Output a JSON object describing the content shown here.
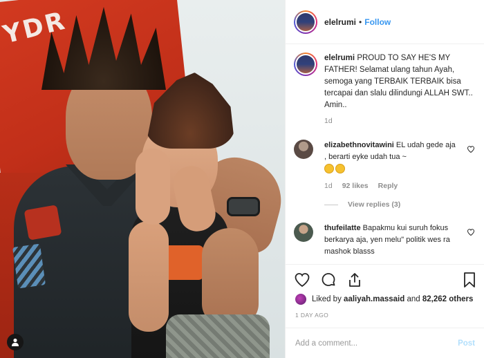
{
  "post": {
    "username": "elelrumi",
    "follow_label": "Follow",
    "separator": "•"
  },
  "caption": {
    "username": "elelrumi",
    "text": "PROUD TO SAY HE'S MY FATHER! Selamat ulang tahun Ayah, semoga yang TERBAIK TERBAIK bisa tercapai dan slalu dilindungi ALLAH SWT.. Amin..",
    "time": "1d"
  },
  "comments": [
    {
      "username": "elizabethnovitawini",
      "text": "EL udah gede aja , berarti eyke udah tua ~",
      "time": "1d",
      "likes": "92 likes",
      "reply_label": "Reply",
      "view_replies": "View replies (3)"
    },
    {
      "username": "thufeilatte",
      "text": "Bapakmu kui suruh fokus berkarya aja, yen melu\" politik wes ra mashok blasss"
    }
  ],
  "liked_by": {
    "prefix": "Liked by",
    "user": "aaliyah.massaid",
    "and": "and",
    "count": "82,262 others"
  },
  "post_date": "1 DAY AGO",
  "add_comment": {
    "placeholder": "Add a comment...",
    "post_label": "Post"
  },
  "photo": {
    "sign_text": "YDR",
    "icons": [
      "user-tag-icon"
    ]
  },
  "colors": {
    "follow": "#3897f0",
    "post_disabled": "#b2dffc",
    "muted": "#8e8e8e",
    "text": "#262626"
  }
}
